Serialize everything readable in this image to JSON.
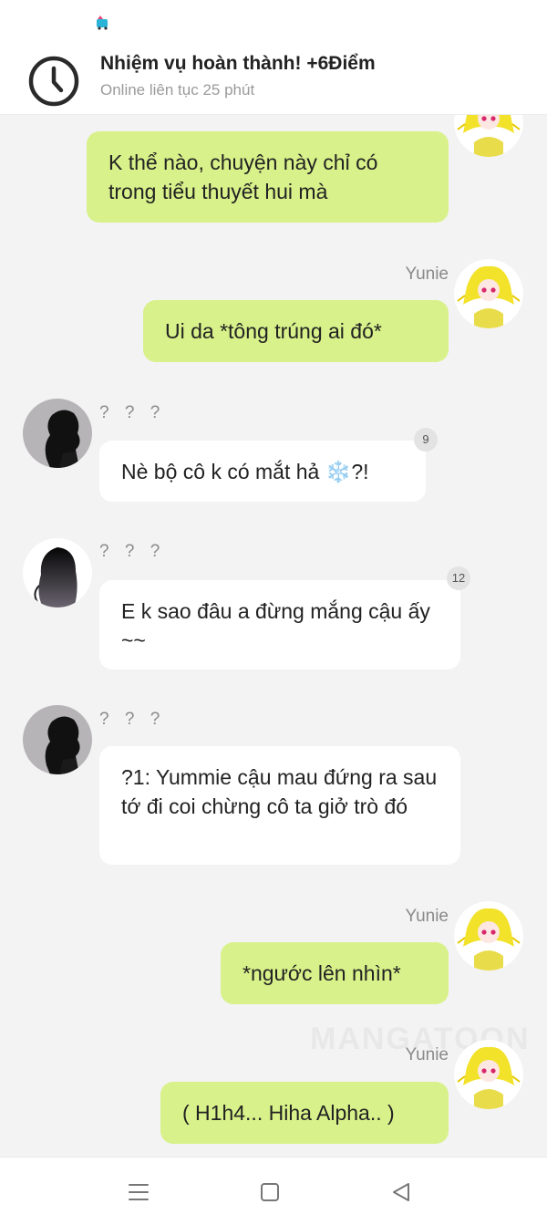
{
  "notification": {
    "title": "Nhiệm vụ hoàn thành! +6Điểm",
    "subtitle": "Online liên tục 25 phút",
    "icon": "clock-icon"
  },
  "chat": {
    "messages": [
      {
        "side": "me",
        "sender": "",
        "text": "K thể nào, chuyện này chỉ có trong tiểu thuyết hui mà"
      },
      {
        "side": "me",
        "sender": "Yunie",
        "text": "Ui da  *tông trúng ai đó*"
      },
      {
        "side": "them",
        "sender": "? ? ?",
        "text": "Nè bộ cô k có mắt hả ❄️?!",
        "badge": "9"
      },
      {
        "side": "them",
        "sender": "? ? ?",
        "text": "E k sao đâu a đừng mắng cậu ấy ~~",
        "badge": "12"
      },
      {
        "side": "them",
        "sender": "? ? ?",
        "text": "?1: Yummie cậu mau đứng ra sau tớ đi coi chừng cô ta giở trò đó"
      },
      {
        "side": "me",
        "sender": "Yunie",
        "text": "*ngước lên nhìn*"
      },
      {
        "side": "me",
        "sender": "Yunie",
        "text": "( H1h4... Hiha Alpha.. )"
      }
    ]
  },
  "watermark": "MANGATOON",
  "navbar": {
    "menu_icon": "menu-icon",
    "home_icon": "home-square-icon",
    "back_icon": "back-triangle-icon"
  },
  "colors": {
    "my_bubble": "#d8f18a",
    "their_bubble": "#ffffff",
    "background": "#f3f3f3"
  }
}
